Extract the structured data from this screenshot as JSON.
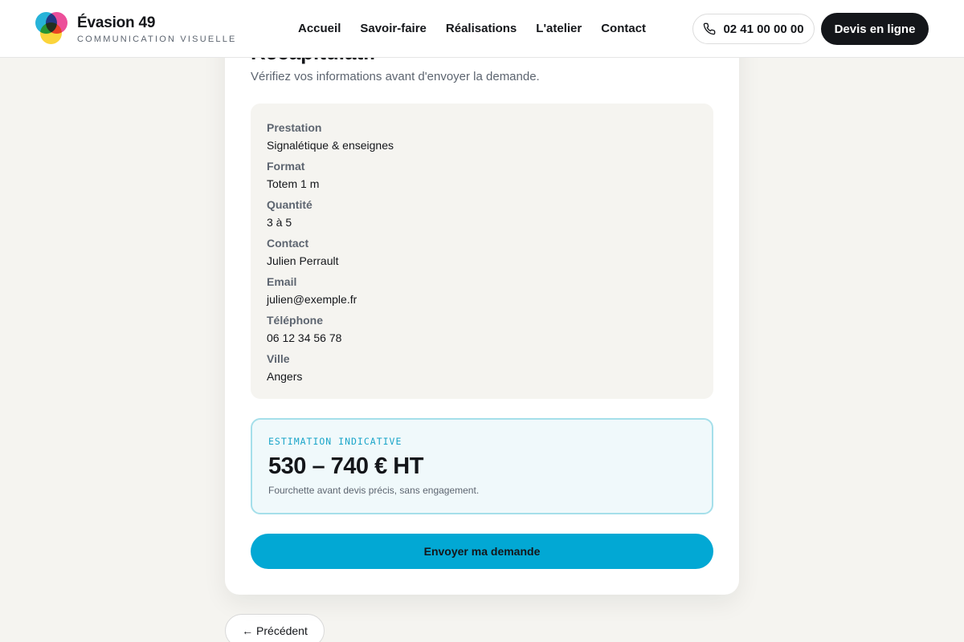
{
  "header": {
    "brand_name": "Évasion 49",
    "brand_tagline": "COMMUNICATION VISUELLE",
    "logo_colors": [
      "#27b3d9",
      "#ec4f9a",
      "#fbd43b"
    ],
    "nav": [
      {
        "label": "Accueil"
      },
      {
        "label": "Savoir-faire"
      },
      {
        "label": "Réalisations"
      },
      {
        "label": "L'atelier"
      },
      {
        "label": "Contact"
      }
    ],
    "phone_icon": "phone-icon",
    "phone_label": "02 41 00 00 00",
    "cta_label": "Devis en ligne"
  },
  "card": {
    "heading": "Récapitulatif",
    "subtitle": "Vérifiez vos informations avant d'envoyer la demande.",
    "summary": [
      {
        "label": "Prestation",
        "value": "Signalétique & enseignes"
      },
      {
        "label": "Format",
        "value": "Totem 1 m"
      },
      {
        "label": "Quantité",
        "value": "3 à 5"
      },
      {
        "label": "Contact",
        "value": "Julien Perrault"
      },
      {
        "label": "Email",
        "value": "julien@exemple.fr"
      },
      {
        "label": "Téléphone",
        "value": "06 12 34 56 78"
      },
      {
        "label": "Ville",
        "value": "Angers"
      }
    ],
    "estimate": {
      "label": "ESTIMATION INDICATIVE",
      "amount": "530 – 740 € HT",
      "note": "Fourchette avant devis précis, sans engagement."
    },
    "submit_label": "Envoyer ma demande"
  },
  "prev_label": "← Précédent",
  "colors": {
    "accent": "#02a8d4",
    "dark": "#14161a",
    "background": "#f5f4f0",
    "estimate_border": "#a5dfea"
  }
}
